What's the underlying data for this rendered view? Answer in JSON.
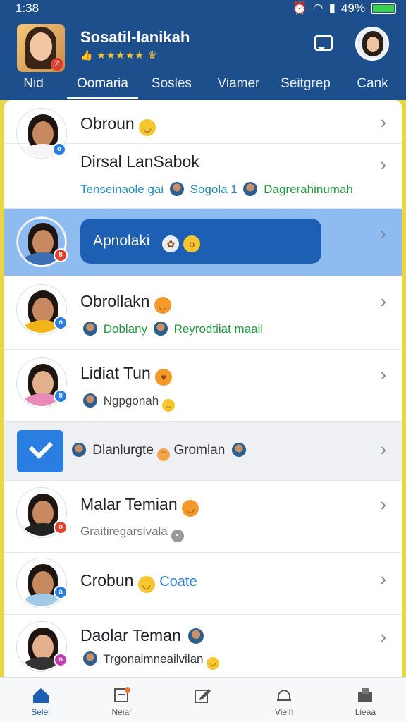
{
  "statusbar": {
    "time": "1:38",
    "battery": "49%"
  },
  "header": {
    "title": "Sosatil-lanikah",
    "rating_stars": "★★★★★",
    "tabs": [
      "Nid",
      "Oomaria",
      "Sosles",
      "Viamer",
      "Seitgrep",
      "Cank"
    ],
    "active_tab": 1
  },
  "list": {
    "rows": [
      {
        "name": "Obroun",
        "emoji": "😏"
      },
      {
        "name": "Dirsal LanSabok",
        "sub1": "Tenseinaole gai",
        "sub2": "Sogola 1",
        "sub3": "Dagrerahinumah"
      },
      {
        "pill_text": "Apnolaki"
      },
      {
        "name": "Obrollakn",
        "sub1": "Doblany",
        "sub2": "Reyrodtiiat maail"
      },
      {
        "name": "Lidiat Tun",
        "sub1": "Ngpgonah"
      },
      {
        "sub1": "Dlanlurgte",
        "sub2": "Gromlan"
      },
      {
        "name": "Malar Temian",
        "sub1": "Graitiregarslvala"
      },
      {
        "name": "Crobun",
        "sub1": "Coate"
      },
      {
        "name": "Daolar Teman",
        "sub1": "Trgonaimneailvilan"
      }
    ]
  },
  "bottomnav": [
    "Selei",
    "Neiar",
    "",
    "Vielh",
    "Lieaa"
  ],
  "colors": {
    "header": "#1d4f8c",
    "accent": "#1d5fb3",
    "green": "#1f9a3a"
  }
}
